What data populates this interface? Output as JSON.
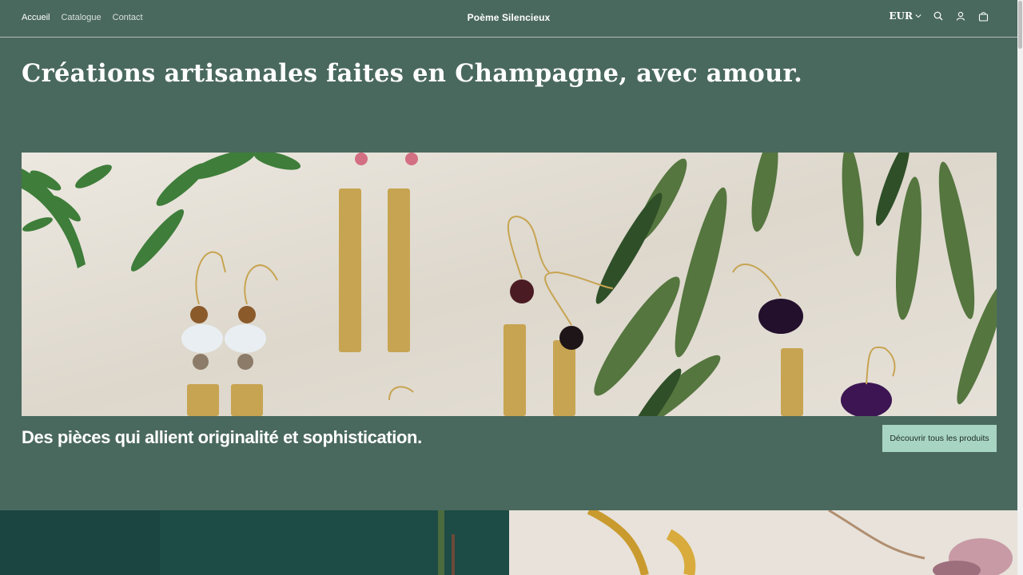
{
  "header": {
    "nav": [
      {
        "label": "Accueil",
        "active": true
      },
      {
        "label": "Catalogue",
        "active": false
      },
      {
        "label": "Contact",
        "active": false
      }
    ],
    "brand": "Poème Silencieux",
    "currency": "EUR",
    "icons": [
      "search-icon",
      "account-icon",
      "cart-icon"
    ]
  },
  "hero": {
    "title": "Créations artisanales faites en Champagne, avec amour.",
    "subtitle": "Des pièces qui allient originalité et sophistication.",
    "cta_label": "Découvrir tous les produits"
  },
  "colors": {
    "background": "#4a695e",
    "button": "#a8d4c4",
    "text": "#ffffff"
  }
}
